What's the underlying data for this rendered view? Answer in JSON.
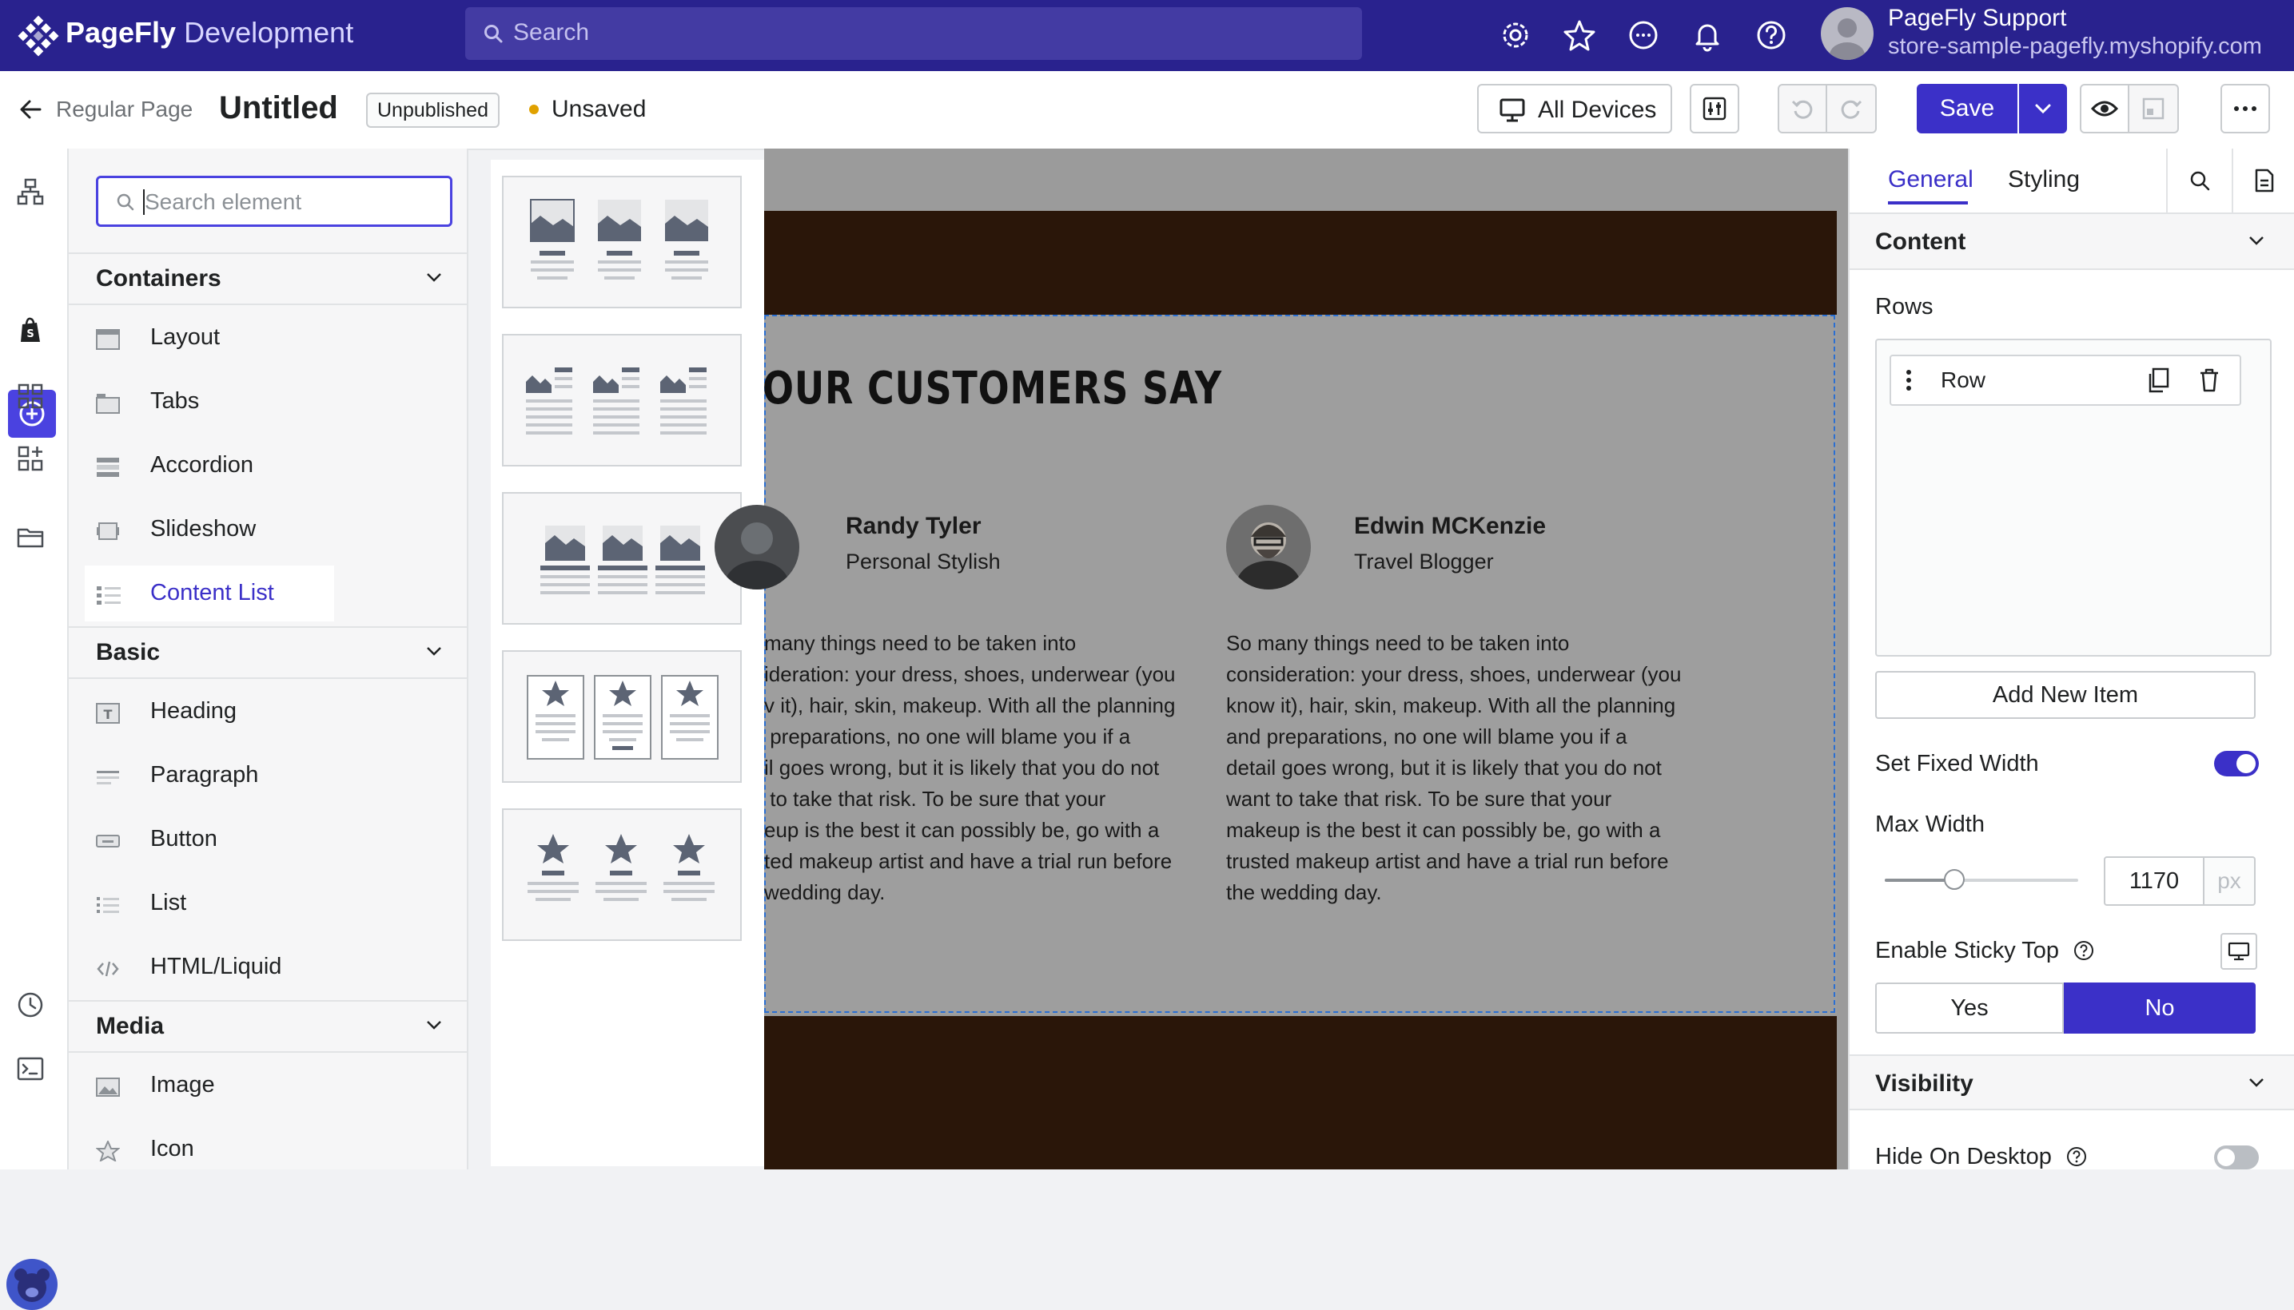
{
  "topbar": {
    "brand": "PageFly",
    "brand_suffix": "Development",
    "search_placeholder": "Search",
    "user_name": "PageFly Support",
    "user_store": "store-sample-pagefly.myshopify.com",
    "icons": [
      "settings-gear-icon",
      "star-icon",
      "chat-icon",
      "bell-icon",
      "help-icon"
    ]
  },
  "toolbar": {
    "page_type": "Regular Page",
    "page_title": "Untitled",
    "status_badge": "Unpublished",
    "save_status": "Unsaved",
    "devices_label": "All Devices",
    "save_label": "Save"
  },
  "element_panel": {
    "search_placeholder": "Search element",
    "sections": [
      {
        "title": "Containers",
        "items": [
          "Layout",
          "Tabs",
          "Accordion",
          "Slideshow",
          "Content List"
        ]
      },
      {
        "title": "Basic",
        "items": [
          "Heading",
          "Paragraph",
          "Button",
          "List",
          "HTML/Liquid"
        ]
      },
      {
        "title": "Media",
        "items": [
          "Image",
          "Icon"
        ]
      }
    ],
    "active_item": "Content List"
  },
  "canvas": {
    "heading": "OUR CUSTOMERS SAY",
    "testimonials": [
      {
        "name": "Randy Tyler",
        "role": "Personal Stylish",
        "body": "many things need to be taken into\nideration: your dress, shoes, underwear (you\nv it), hair, skin, makeup. With all the planning\n preparations, no one will blame you if a\nil goes wrong, but it is likely that you do not\n to take that risk. To be sure that your\neup is the best it can possibly be, go with a\nted makeup artist and have a trial run before\nwedding day."
      },
      {
        "name": "Edwin MCKenzie",
        "role": "Travel Blogger",
        "body": "So many things need to be taken into\nconsideration: your dress, shoes, underwear (you\nknow it), hair, skin, makeup. With all the planning\nand preparations, no one will blame you if a\ndetail goes wrong, but it is likely that you do not\nwant to take that risk. To be sure that your\nmakeup is the best it can possibly be, go with a\ntrusted makeup artist and have a trial run before\nthe wedding day."
      }
    ]
  },
  "right_panel": {
    "tabs": [
      "General",
      "Styling"
    ],
    "content_title": "Content",
    "rows_label": "Rows",
    "row_item": "Row",
    "add_item_label": "Add New Item",
    "fixed_width_label": "Set Fixed Width",
    "fixed_width_on": true,
    "max_width_label": "Max Width",
    "max_width_value": "1170",
    "max_width_unit": "px",
    "sticky_label": "Enable Sticky Top",
    "yes_label": "Yes",
    "no_label": "No",
    "sticky_selected": "No",
    "visibility_title": "Visibility",
    "hide_desktop_label": "Hide On Desktop",
    "hide_desktop_on": false
  },
  "colors": {
    "topbar_bg": "#29228e",
    "accent": "#3b30c8",
    "canvas_band": "#2a1609",
    "selection_outline": "#2b6fd1"
  }
}
